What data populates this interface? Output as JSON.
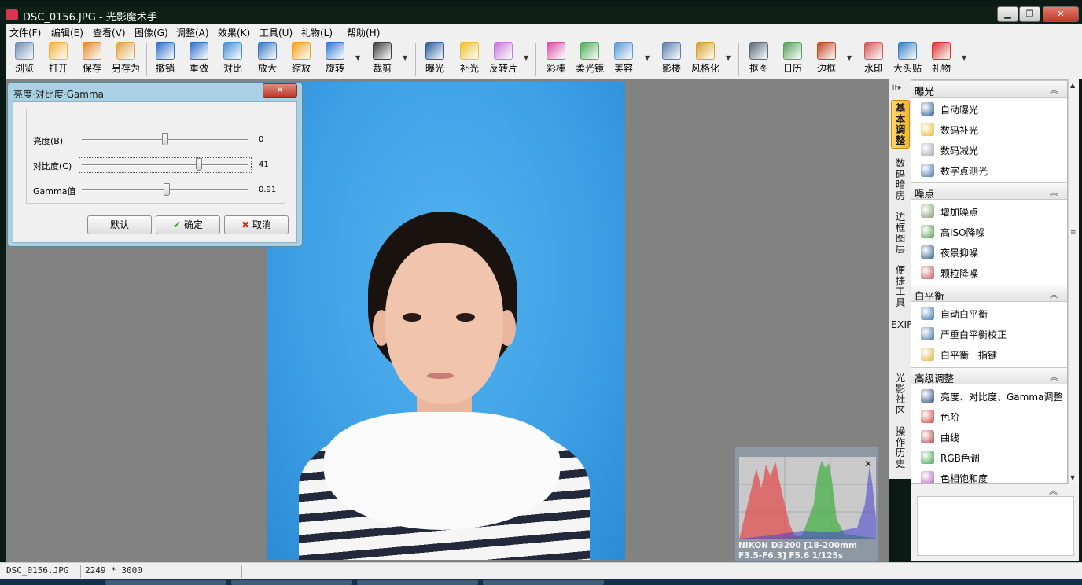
{
  "window": {
    "title": "DSC_0156.JPG - 光影魔术手",
    "min": "▁",
    "max": "❐",
    "close": "✕"
  },
  "menu": [
    "文件(F)",
    "编辑(E)",
    "查看(V)",
    "图像(G)",
    "调整(A)",
    "效果(K)",
    "工具(U)",
    "礼物(L)",
    "帮助(H)"
  ],
  "toolbar": [
    {
      "label": "浏览",
      "icon": "eye-icon",
      "color": "#6b8fb5"
    },
    {
      "label": "打开",
      "icon": "folder-open-icon",
      "color": "#f2b43b"
    },
    {
      "label": "保存",
      "icon": "save-icon",
      "color": "#e08a2a"
    },
    {
      "label": "另存为",
      "icon": "save-as-icon",
      "color": "#e4a34a"
    },
    {
      "label": "撤销",
      "icon": "undo-icon",
      "color": "#2f6fc9"
    },
    {
      "label": "重做",
      "icon": "redo-icon",
      "color": "#2f6fc9"
    },
    {
      "label": "对比",
      "icon": "compare-icon",
      "color": "#4a90d0"
    },
    {
      "label": "放大",
      "icon": "zoom-in-icon",
      "color": "#3a78c2"
    },
    {
      "label": "缩放",
      "icon": "resize-icon",
      "color": "#f0a020"
    },
    {
      "label": "旋转",
      "icon": "rotate-icon",
      "color": "#2e79d0"
    },
    {
      "label": "裁剪",
      "icon": "crop-icon",
      "color": "#3d3d3d"
    },
    {
      "label": "曝光",
      "icon": "exposure-icon",
      "color": "#2c5f9e"
    },
    {
      "label": "补光",
      "icon": "fill-light-icon",
      "color": "#e8c030"
    },
    {
      "label": "反转片",
      "icon": "slide-film-icon",
      "color": "#c57ad8"
    },
    {
      "label": "彩棒",
      "icon": "color-wand-icon",
      "color": "#d94ca6"
    },
    {
      "label": "柔光镜",
      "icon": "soft-lens-icon",
      "color": "#4fae5c"
    },
    {
      "label": "美容",
      "icon": "beauty-icon",
      "color": "#5a9bd6"
    },
    {
      "label": "影楼",
      "icon": "studio-icon",
      "color": "#5c7fb0"
    },
    {
      "label": "风格化",
      "icon": "stylize-icon",
      "color": "#d7a02a"
    },
    {
      "label": "抠图",
      "icon": "cutout-icon",
      "color": "#5a6b7a"
    },
    {
      "label": "日历",
      "icon": "calendar-icon",
      "color": "#58a05a"
    },
    {
      "label": "边框",
      "icon": "frame-icon",
      "color": "#c04a28"
    },
    {
      "label": "水印",
      "icon": "watermark-icon",
      "color": "#d25a5a"
    },
    {
      "label": "大头贴",
      "icon": "sticker-icon",
      "color": "#3a7fc0"
    },
    {
      "label": "礼物",
      "icon": "gift-icon",
      "color": "#d9352f"
    }
  ],
  "dialog": {
    "title": "亮度·对比度·Gamma",
    "close": "✕",
    "sliders": [
      {
        "label": "亮度(B)",
        "value": "0",
        "fraction": 0.5
      },
      {
        "label": "对比度(C)",
        "value": "41",
        "fraction": 0.705
      },
      {
        "label": "Gamma值",
        "value": "0.91",
        "fraction": 0.51
      }
    ],
    "buttons": {
      "default": "默认",
      "ok": "确定",
      "cancel": "取消",
      "ok_icon": "✔",
      "cancel_icon": "✖"
    }
  },
  "histogram": {
    "close": "✕",
    "exif_line1": "NIKON D3200 [18-200mm",
    "exif_line2": "F3.5-F6.3] F5.6 1/125s"
  },
  "side_tabs": [
    "基本调整",
    "数码暗房",
    "边框图层",
    "便捷工具",
    "EXIF",
    "光影社区",
    "操作历史"
  ],
  "panel": {
    "collapse": "︽",
    "sections": [
      {
        "title": "曝光",
        "items": [
          {
            "label": "自动曝光",
            "icon": "auto-exposure-icon",
            "color": "#2c5f9e"
          },
          {
            "label": "数码补光",
            "icon": "digital-fill-light-icon",
            "color": "#e8b830"
          },
          {
            "label": "数码减光",
            "icon": "digital-reduce-light-icon",
            "color": "#9aa3b0"
          },
          {
            "label": "数字点测光",
            "icon": "spot-metering-icon",
            "color": "#3a6fb0"
          }
        ]
      },
      {
        "title": "噪点",
        "items": [
          {
            "label": "增加噪点",
            "icon": "add-noise-icon",
            "color": "#7aa06a"
          },
          {
            "label": "高ISO降噪",
            "icon": "iso-denoise-icon",
            "color": "#4f9a4f"
          },
          {
            "label": "夜景抑噪",
            "icon": "night-denoise-icon",
            "color": "#2d5d8a"
          },
          {
            "label": "颗粒降噪",
            "icon": "grain-denoise-icon",
            "color": "#c85050"
          }
        ]
      },
      {
        "title": "白平衡",
        "items": [
          {
            "label": "自动白平衡",
            "icon": "auto-wb-icon",
            "color": "#3a6fa8"
          },
          {
            "label": "严重白平衡校正",
            "icon": "wb-correct-icon",
            "color": "#3a6fa8"
          },
          {
            "label": "白平衡一指键",
            "icon": "wb-one-click-icon",
            "color": "#e0b040"
          }
        ]
      },
      {
        "title": "高级调整",
        "items": [
          {
            "label": "亮度、对比度、Gamma调整",
            "icon": "brightness-contrast-icon",
            "color": "#2b4f80"
          },
          {
            "label": "色阶",
            "icon": "levels-icon",
            "color": "#d0403a"
          },
          {
            "label": "曲线",
            "icon": "curves-icon",
            "color": "#b04040"
          },
          {
            "label": "RGB色调",
            "icon": "rgb-icon",
            "color": "#3aa050"
          },
          {
            "label": "色相饱和度",
            "icon": "hue-saturation-icon",
            "color": "#b560c0"
          }
        ]
      }
    ]
  },
  "status": {
    "filename": "DSC_0156.JPG",
    "dimensions": "2249 * 3000"
  }
}
